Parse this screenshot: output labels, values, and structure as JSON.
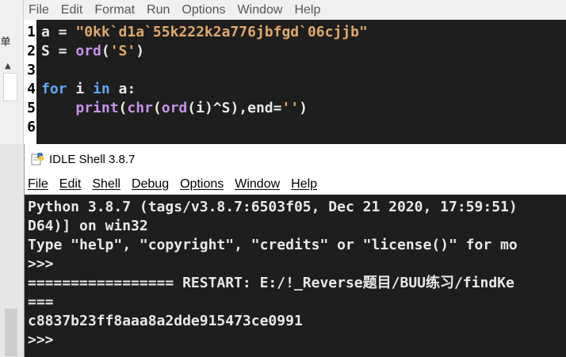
{
  "left_strip": {
    "glyph": "单",
    "scroll_arrow": "▲"
  },
  "editor": {
    "menu": [
      "File",
      "Edit",
      "Format",
      "Run",
      "Options",
      "Window",
      "Help"
    ],
    "line_numbers": [
      "1",
      "2",
      "3",
      "4",
      "5",
      "6"
    ],
    "lines": [
      [
        {
          "t": "a = ",
          "c": "wh"
        },
        {
          "t": "\"0kk`d1a`55k222k2a776jbfgd`06cjjb\"",
          "c": "str"
        }
      ],
      [
        {
          "t": "S = ",
          "c": "wh"
        },
        {
          "t": "ord",
          "c": "bi"
        },
        {
          "t": "(",
          "c": "wh"
        },
        {
          "t": "'S'",
          "c": "str"
        },
        {
          "t": ")",
          "c": "wh"
        }
      ],
      [],
      [
        {
          "t": "for",
          "c": "kw"
        },
        {
          "t": " i ",
          "c": "wh"
        },
        {
          "t": "in",
          "c": "kw"
        },
        {
          "t": " a:",
          "c": "wh"
        }
      ],
      [
        {
          "t": "    ",
          "c": "wh"
        },
        {
          "t": "print",
          "c": "bi"
        },
        {
          "t": "(",
          "c": "wh"
        },
        {
          "t": "chr",
          "c": "bi"
        },
        {
          "t": "(",
          "c": "wh"
        },
        {
          "t": "ord",
          "c": "bi"
        },
        {
          "t": "(i)^S),end=",
          "c": "wh"
        },
        {
          "t": "''",
          "c": "str"
        },
        {
          "t": ")",
          "c": "wh"
        }
      ],
      []
    ]
  },
  "shell": {
    "title": "IDLE Shell 3.8.7",
    "menu": [
      "File",
      "Edit",
      "Shell",
      "Debug",
      "Options",
      "Window",
      "Help"
    ],
    "lines": [
      {
        "t": "Python 3.8.7 (tags/v3.8.7:6503f05, Dec 21 2020, 17:59:51)",
        "c": "wh"
      },
      {
        "t": "D64)] on win32",
        "c": "wh"
      },
      {
        "t": "Type \"help\", \"copyright\", \"credits\" or \"license()\" for mo",
        "c": "wh"
      },
      {
        "t": ">>>",
        "c": "prompt"
      },
      {
        "t": "================= RESTART: E:/!_Reverse题目/BUU练习/findKe",
        "c": "wh"
      },
      {
        "t": "===",
        "c": "wh"
      },
      {
        "t": "c8837b23ff8aaa8a2dde915473ce0991",
        "c": "wh"
      },
      {
        "t": ">>>",
        "c": "prompt"
      }
    ]
  },
  "colors": {
    "background": "#1e1e1e",
    "keyword": "#5fa8f5",
    "string": "#e0a86a",
    "builtin": "#c792ea",
    "prompt": "#4f9cf0"
  }
}
